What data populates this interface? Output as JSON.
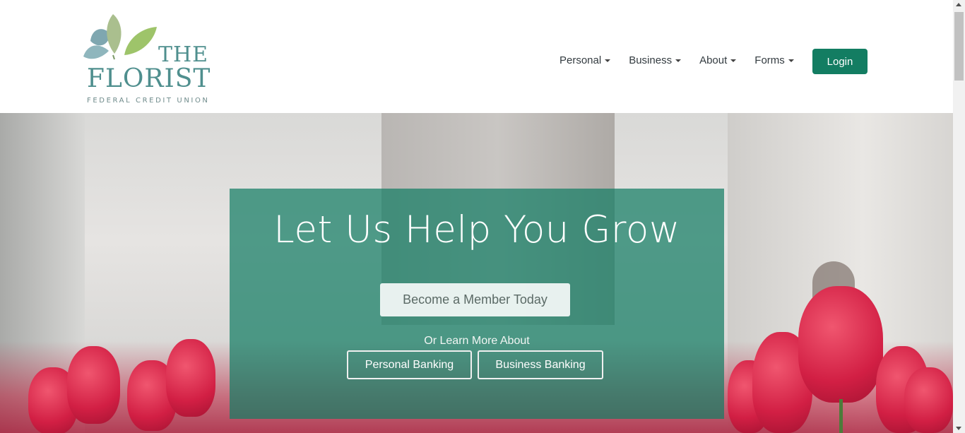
{
  "brand": {
    "line1": "THE",
    "line2": "FLORIST",
    "line3": "FEDERAL CREDIT UNION"
  },
  "nav": {
    "items": [
      {
        "label": "Personal"
      },
      {
        "label": "Business"
      },
      {
        "label": "About"
      },
      {
        "label": "Forms"
      }
    ],
    "login_label": "Login"
  },
  "hero": {
    "headline": "Let Us Help You Grow",
    "cta_label": "Become a Member Today",
    "learn_more": "Or Learn More About",
    "personal_label": "Personal Banking",
    "business_label": "Business Banking"
  },
  "colors": {
    "brand_green": "#137d62",
    "panel": "#147d64",
    "logo_teal": "#4f8f8e"
  }
}
